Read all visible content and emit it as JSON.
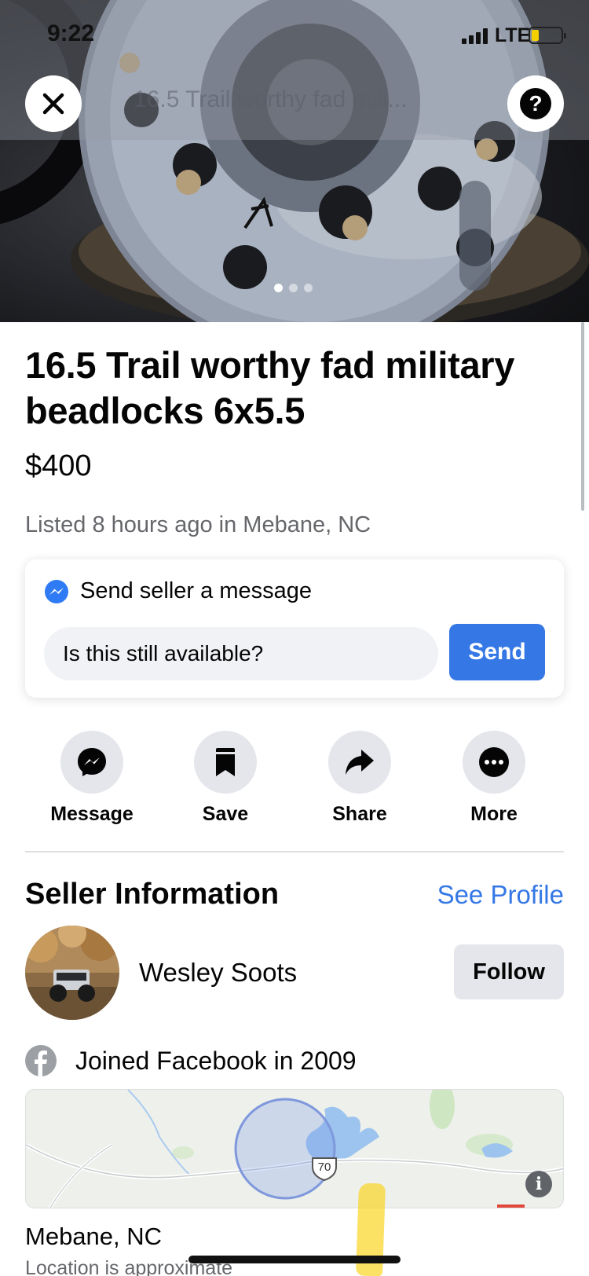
{
  "status_bar": {
    "time": "9:22",
    "network": "LTE",
    "battery_color": "#f5d000"
  },
  "header": {
    "close_icon": "close-icon",
    "title": "16.5  Trail worthy fad mili...",
    "help_label": "?"
  },
  "gallery": {
    "image_count": 3,
    "active_index": 0
  },
  "listing": {
    "title": "16.5   Trail worthy fad military beadlocks 6x5.5",
    "price": "$400",
    "listed": "Listed 8 hours ago in Mebane, NC"
  },
  "message_card": {
    "heading": "Send seller a message",
    "input_value": "Is this still available?",
    "send_label": "Send",
    "accent_color": "#3578e5"
  },
  "actions": [
    {
      "label": "Message",
      "icon": "messenger-icon"
    },
    {
      "label": "Save",
      "icon": "bookmark-icon"
    },
    {
      "label": "Share",
      "icon": "share-arrow-icon"
    },
    {
      "label": "More",
      "icon": "more-dots-icon"
    }
  ],
  "seller": {
    "heading": "Seller Information",
    "see_profile": "See Profile",
    "name": "Wesley Soots",
    "follow_label": "Follow",
    "joined": "Joined Facebook in 2009"
  },
  "map": {
    "route_shield": "70",
    "info_label": "i"
  },
  "location": {
    "name": "Mebane, NC",
    "note": "Location is approximate"
  }
}
